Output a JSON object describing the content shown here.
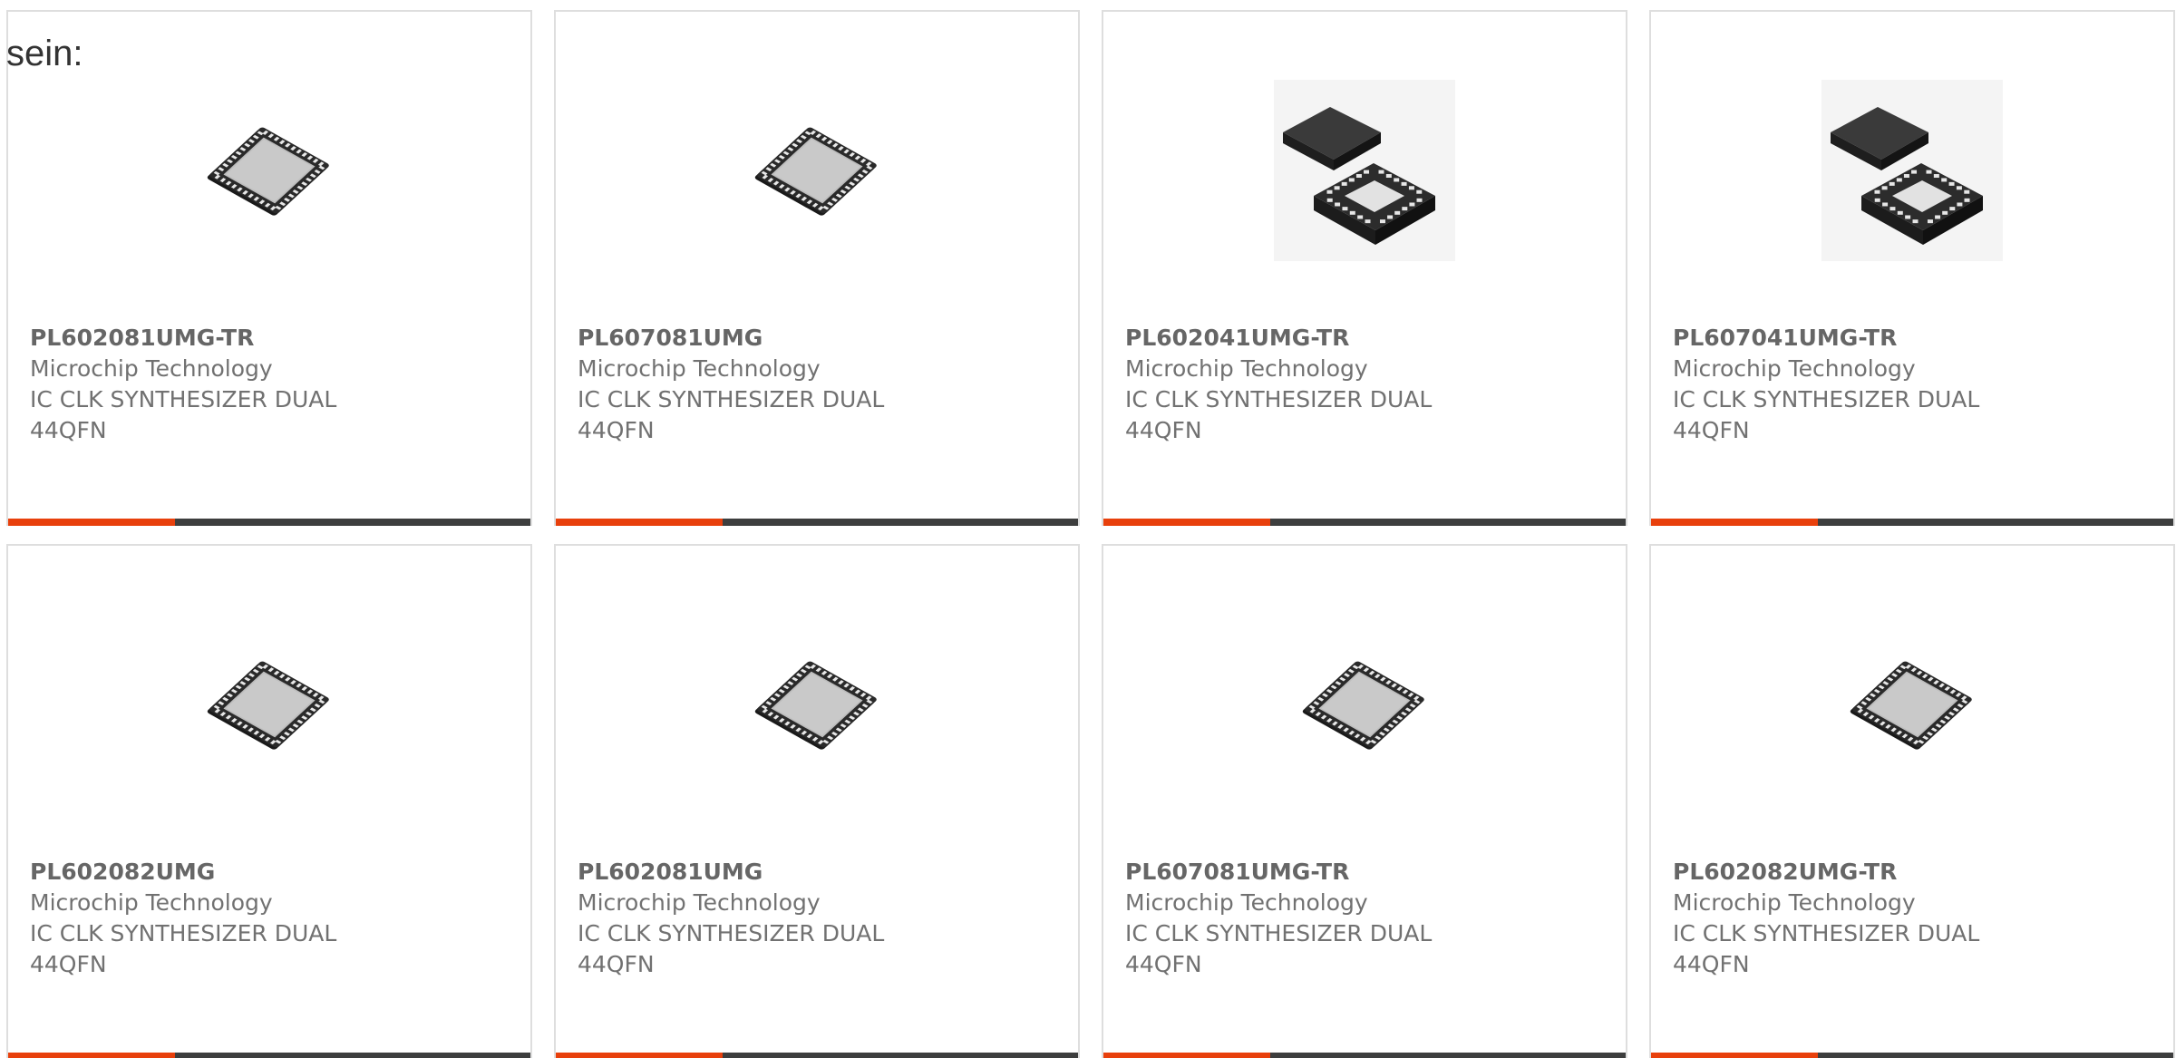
{
  "intro_text": "sein:",
  "colors": {
    "accent": "#e8400c",
    "bar_dark": "#3d3e3e",
    "card_border": "#dedede",
    "text": "#717171"
  },
  "products": [
    {
      "part_number": "PL602081UMG-TR",
      "manufacturer": "Microchip Technology",
      "description": "IC CLK SYNTHESIZER DUAL 44QFN",
      "image": "qfn-44-chip-icon"
    },
    {
      "part_number": "PL607081UMG",
      "manufacturer": "Microchip Technology",
      "description": "IC CLK SYNTHESIZER DUAL 44QFN",
      "image": "qfn-44-chip-icon"
    },
    {
      "part_number": "PL602041UMG-TR",
      "manufacturer": "Microchip Technology",
      "description": "IC CLK SYNTHESIZER DUAL 44QFN",
      "image": "qfn-24-chip-pair-icon"
    },
    {
      "part_number": "PL607041UMG-TR",
      "manufacturer": "Microchip Technology",
      "description": "IC CLK SYNTHESIZER DUAL 44QFN",
      "image": "qfn-24-chip-pair-icon"
    },
    {
      "part_number": "PL602082UMG",
      "manufacturer": "Microchip Technology",
      "description": "IC CLK SYNTHESIZER DUAL 44QFN",
      "image": "qfn-44-chip-icon"
    },
    {
      "part_number": "PL602081UMG",
      "manufacturer": "Microchip Technology",
      "description": "IC CLK SYNTHESIZER DUAL 44QFN",
      "image": "qfn-44-chip-icon"
    },
    {
      "part_number": "PL607081UMG-TR",
      "manufacturer": "Microchip Technology",
      "description": "IC CLK SYNTHESIZER DUAL 44QFN",
      "image": "qfn-44-chip-icon"
    },
    {
      "part_number": "PL602082UMG-TR",
      "manufacturer": "Microchip Technology",
      "description": "IC CLK SYNTHESIZER DUAL 44QFN",
      "image": "qfn-44-chip-icon"
    }
  ]
}
